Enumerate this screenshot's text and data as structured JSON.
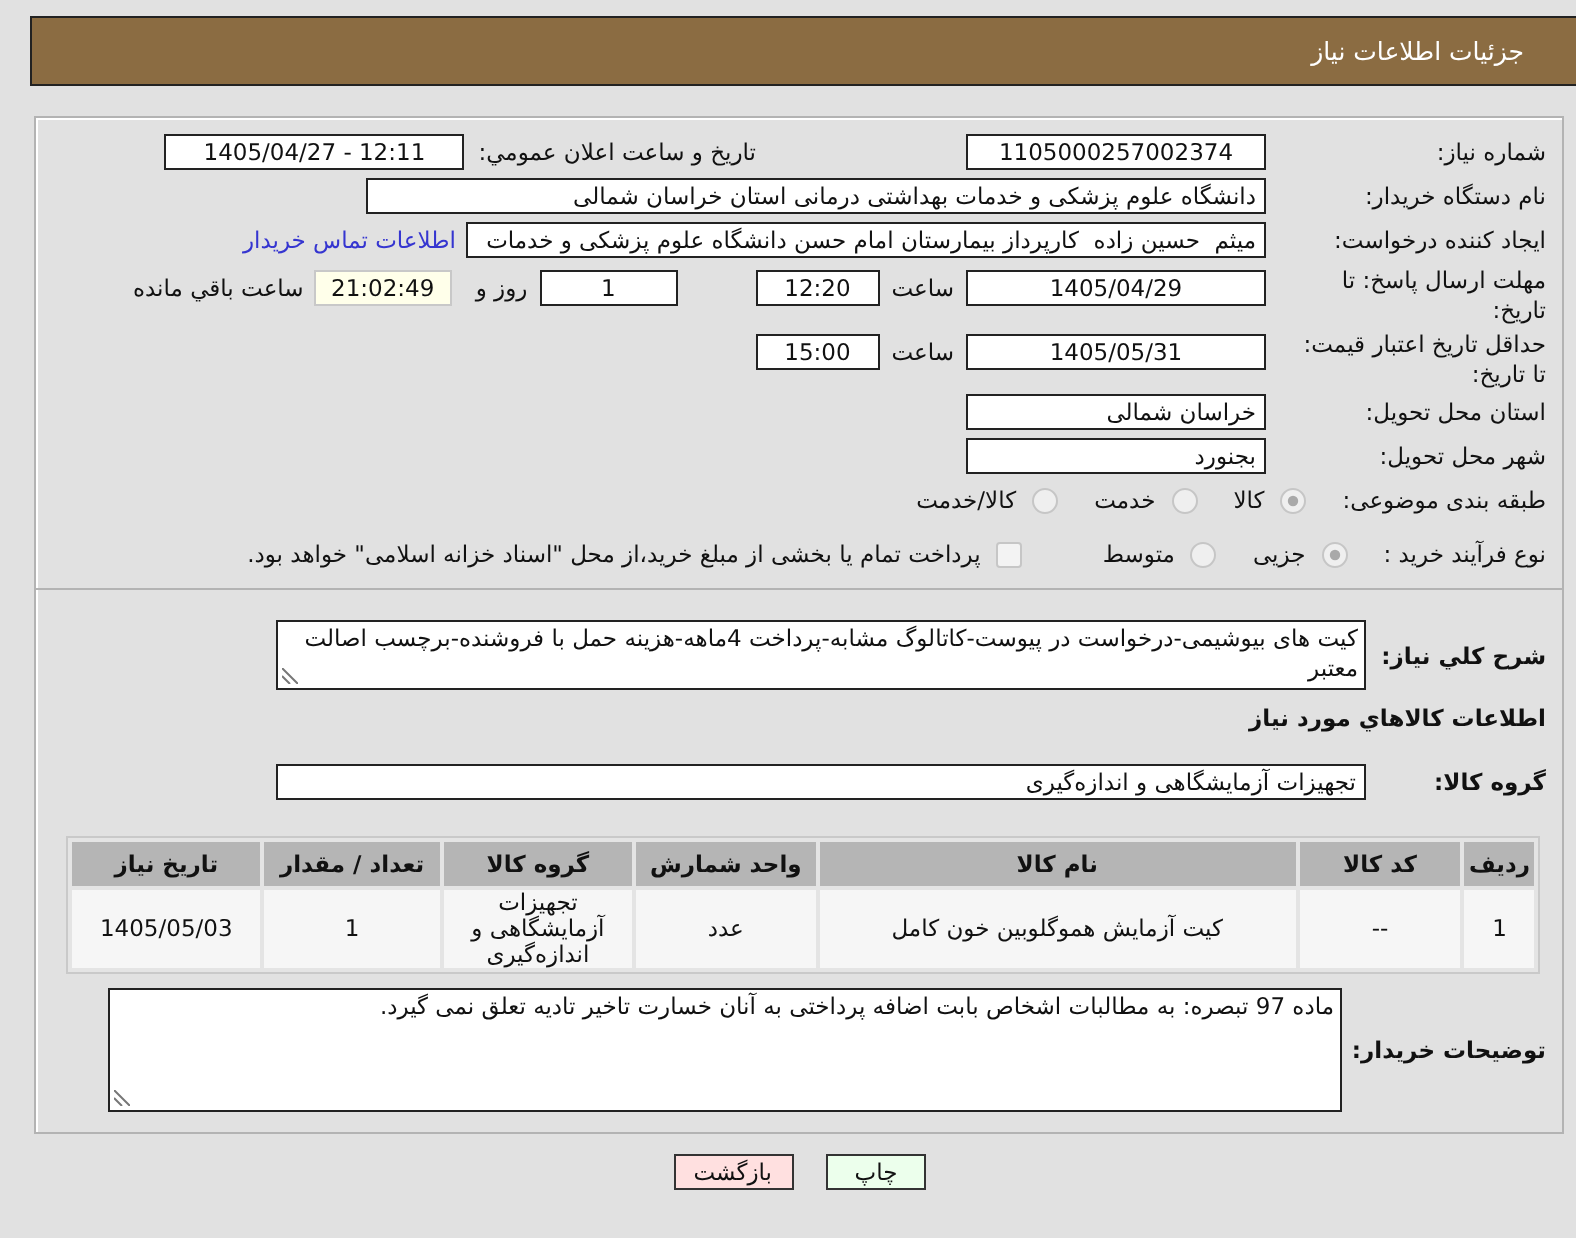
{
  "header": {
    "title": "جزئیات اطلاعات نیاز"
  },
  "need_number": {
    "label": "شماره نیاز:",
    "value": "1105000257002374"
  },
  "announce_datetime": {
    "label": "تاریخ و ساعت اعلان عمومي:",
    "value": "1405/04/27 - 12:11"
  },
  "buyer_org": {
    "label": "نام دستگاه خریدار:",
    "value": "دانشگاه علوم پزشکی و خدمات بهداشتی درمانی استان خراسان شمالی"
  },
  "requester": {
    "label": "ایجاد کننده درخواست:",
    "value": "میثم  حسین زاده  کارپرداز بیمارستان امام حسن دانشگاه علوم پزشکی و خدمات",
    "link": "اطلاعات تماس خریدار"
  },
  "response_deadline": {
    "label": "مهلت ارسال پاسخ: تا تاریخ:",
    "date": "1405/04/29",
    "time_label": "ساعت",
    "time": "12:20",
    "days": "1",
    "days_label": "روز و",
    "remaining": "21:02:49",
    "remaining_label": "ساعت باقي مانده"
  },
  "price_validity": {
    "label": "حداقل تاریخ اعتبار قیمت: تا تاریخ:",
    "date": "1405/05/31",
    "time_label": "ساعت",
    "time": "15:00"
  },
  "delivery_province": {
    "label": "استان محل تحویل:",
    "value": "خراسان شمالی"
  },
  "delivery_city": {
    "label": "شهر محل تحویل:",
    "value": "بجنورد"
  },
  "subject_category": {
    "label": "طبقه بندی موضوعی:",
    "disabled": true,
    "options": [
      {
        "label": "کالا",
        "selected": true
      },
      {
        "label": "خدمت",
        "selected": false
      },
      {
        "label": "کالا/خدمت",
        "selected": false
      }
    ]
  },
  "purchase_process": {
    "label": "نوع فرآیند خرید :",
    "disabled": true,
    "options": [
      {
        "label": "جزیی",
        "selected": true
      },
      {
        "label": "متوسط",
        "selected": false
      }
    ],
    "treasury_payment": {
      "label": "پرداخت تمام یا بخشی از مبلغ خرید،از محل \"اسناد خزانه اسلامی\" خواهد بود.",
      "checked": false
    }
  },
  "description": {
    "label": "شرح کلي نیاز:",
    "value": "کیت های بیوشیمی-درخواست در پیوست-کاتالوگ مشابه-پرداخت 4ماهه-هزینه حمل با فروشنده-برچسب اصالت معتبر"
  },
  "goods_heading": "اطلاعات كالاهاي مورد نیاز",
  "goods_group": {
    "label": "گروه کالا:",
    "value": "تجهیزات آزمایشگاهی و اندازه‌گیری"
  },
  "table": {
    "columns": [
      "ردیف",
      "کد کالا",
      "نام کالا",
      "واحد شمارش",
      "گروه کالا",
      "تعداد / مقدار",
      "تاریخ نیاز"
    ],
    "rows": [
      [
        "1",
        "--",
        "کیت آزمایش هموگلوبین خون کامل",
        "عدد",
        "تجهیزات آزمایشگاهی و اندازه‌گیری",
        "1",
        "1405/05/03"
      ]
    ]
  },
  "buyer_notes": {
    "label": "توضیحات خریدار:",
    "value": "ماده 97 تبصره: به مطالبات اشخاص بابت اضافه پرداختی به آنان خسارت تاخیر تادیه تعلق نمی گیرد."
  },
  "buttons": [
    {
      "label": "چاپ",
      "kind": "print"
    },
    {
      "label": "بازگشت",
      "kind": "back"
    }
  ]
}
